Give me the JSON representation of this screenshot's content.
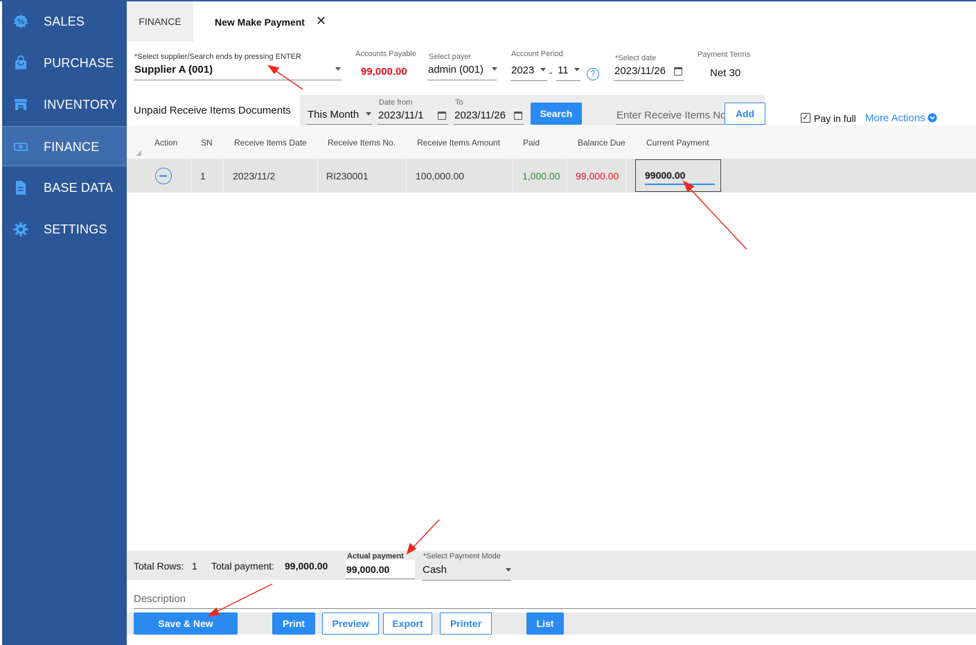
{
  "sidebar": {
    "items": [
      {
        "label": "SALES",
        "icon": "sales-badge-icon"
      },
      {
        "label": "PURCHASE",
        "icon": "shopping-bag-icon"
      },
      {
        "label": "INVENTORY",
        "icon": "warehouse-icon"
      },
      {
        "label": "FINANCE",
        "icon": "money-icon"
      },
      {
        "label": "BASE DATA",
        "icon": "document-icon"
      },
      {
        "label": "SETTINGS",
        "icon": "gear-icon"
      }
    ]
  },
  "tabs": {
    "finance": "FINANCE",
    "new_payment": "New Make Payment",
    "close": "✕"
  },
  "form": {
    "supplier_label": "*Select supplier/Search ends by pressing ENTER",
    "supplier_value": "Supplier A (001)",
    "ap_label": "Accounts Payable",
    "ap_value": "99,000.00",
    "payer_label": "Select payer",
    "payer_value": "admin (001)",
    "period_label": "Account Period",
    "period_year": "2023",
    "period_dash": "-",
    "period_month": "11",
    "help": "?",
    "date_label": "*Select date",
    "date_value": "2023/11/26",
    "terms_label": "Payment Terms",
    "terms_value": "Net 30"
  },
  "filter": {
    "section_title": "Unpaid Receive Items Documents",
    "range_value": "This Month",
    "date_from_label": "Date from",
    "date_from_value": "2023/11/1",
    "to_label": "To",
    "to_value": "2023/11/26",
    "search_label": "Search",
    "enter_placeholder": "Enter Receive Items No.",
    "add_label": "Add",
    "pay_in_full_label": "Pay in full",
    "pay_in_full_check": "✓",
    "more_actions_label": "More Actions"
  },
  "table": {
    "headers": [
      "Action",
      "SN",
      "Receive Items Date",
      "Receive Items No.",
      "Receive Items Amount",
      "Paid",
      "Balance Due",
      "Current Payment"
    ],
    "rows": [
      {
        "sn": "1",
        "date": "2023/11/2",
        "no": "RI230001",
        "amount": "100,000.00",
        "paid": "1,000.00",
        "balance": "99,000.00",
        "current": "99000.00"
      }
    ]
  },
  "footer": {
    "total_rows_label": "Total Rows:",
    "total_rows_value": "1",
    "total_payment_label": "Total payment:",
    "total_payment_value": "99,000.00",
    "actual_payment_label": "Actual payment",
    "actual_payment_value": "99,000.00",
    "mode_label": "*Select Payment Mode",
    "mode_value": "Cash",
    "description_placeholder": "Description"
  },
  "buttons": {
    "save_new": "Save & New",
    "print": "Print",
    "preview": "Preview",
    "export": "Export",
    "printer": "Printer",
    "list": "List"
  },
  "colors": {
    "sidebar": "#2b5698",
    "accent": "#2a8af0",
    "negative": "#e8101a",
    "positive": "#2a8a2a",
    "annotation_arrow": "#f0281e"
  }
}
